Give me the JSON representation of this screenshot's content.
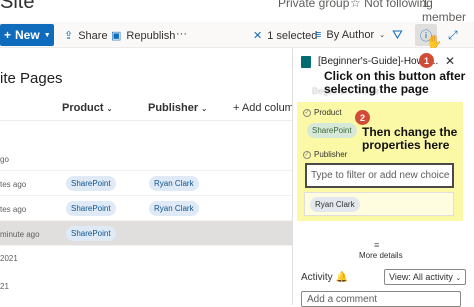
{
  "site": {
    "name": "Site"
  },
  "top_info": {
    "group": "Private group",
    "following": "Not following",
    "members": "1 member"
  },
  "toolbar": {
    "new_label": "New",
    "share_label": "Share",
    "republish_label": "Republish",
    "more_label": "···",
    "selected_label": "1 selected",
    "group_by_label": "By Author"
  },
  "page": {
    "title": "ite Pages"
  },
  "columns": {
    "product": "Product",
    "publisher": "Publisher",
    "add": "Add column"
  },
  "rows": [
    {
      "modified": "go",
      "product": "",
      "publisher": ""
    },
    {
      "modified": "tes ago",
      "product": "SharePoint",
      "publisher": "Ryan Clark"
    },
    {
      "modified": "tes ago",
      "product": "SharePoint",
      "publisher": "Ryan Clark"
    },
    {
      "modified": "minute ago",
      "product": "SharePoint",
      "publisher": ""
    }
  ],
  "footer_year": "2021",
  "footer_small": "21",
  "panel": {
    "doc_title": "[Beginner's-Guide]-How-t...",
    "subtitle": "Beginners Guide",
    "product_label": "Product",
    "product_value": "SharePoint",
    "publisher_label": "Publisher",
    "filter_placeholder": "Type to filter or add new choice",
    "publisher_value": "Ryan Clark",
    "more_details": "More details",
    "activity_label": "Activity",
    "view_label": "View: All activity",
    "comment_placeholder": "Add a comment"
  },
  "callouts": {
    "one_num": "1",
    "one_text": "Click on this button after selecting the page",
    "two_num": "2",
    "two_text": "Then change the properties here"
  },
  "colors": {
    "accent": "#0f6cbd",
    "callout_red": "#d24b36",
    "highlight_yellow": "#fcf9a6"
  }
}
